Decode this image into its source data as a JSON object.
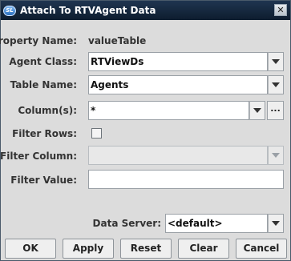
{
  "window": {
    "title": "Attach To RTVAgent Data",
    "icon_text": "SL"
  },
  "form": {
    "property_name": {
      "label": "Property Name:",
      "value": "valueTable"
    },
    "agent_class": {
      "label": "Agent Class:",
      "value": "RTViewDs"
    },
    "table_name": {
      "label": "Table Name:",
      "value": "Agents"
    },
    "columns": {
      "label": "Column(s):",
      "value": "*",
      "browse_label": "..."
    },
    "filter_rows": {
      "label": "Filter Rows:",
      "checked": false
    },
    "filter_column": {
      "label": "Filter Column:",
      "value": ""
    },
    "filter_value": {
      "label": "Filter Value:",
      "value": ""
    },
    "data_server": {
      "label": "Data Server:",
      "value": "<default>"
    }
  },
  "buttons": {
    "ok": "OK",
    "apply": "Apply",
    "reset": "Reset",
    "clear": "Clear",
    "cancel": "Cancel"
  }
}
